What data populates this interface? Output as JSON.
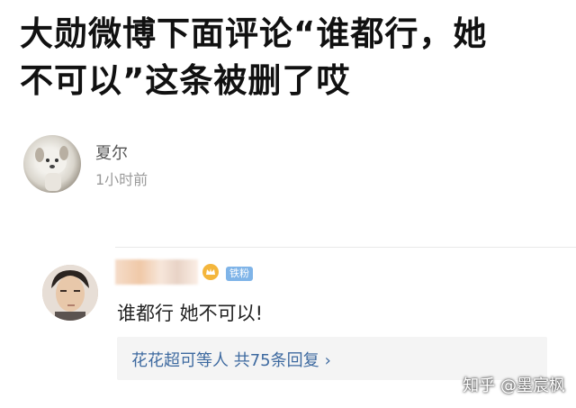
{
  "headline": {
    "line1": "大勋微博下面评论“谁都行，她",
    "line2": "不可以”这条被删了哎"
  },
  "post": {
    "username": "夏尔",
    "time": "1小时前"
  },
  "comment": {
    "level_badge": "铁粉",
    "text": "谁都行 她不可以!",
    "reply_summary": "花花超可等人 共75条回复",
    "reply_chevron": "›"
  },
  "watermark": "知乎 @墨宸枫"
}
